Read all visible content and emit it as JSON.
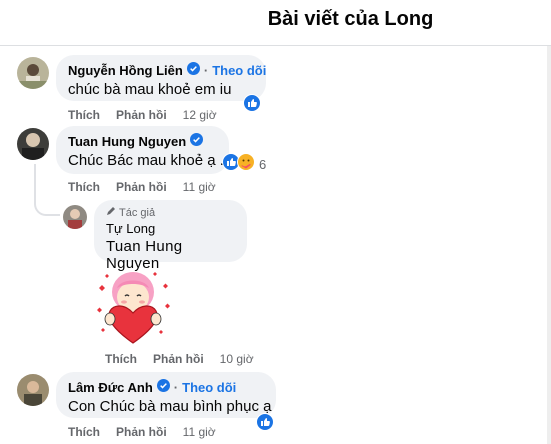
{
  "header": {
    "title": "Bài viết của Long"
  },
  "comments": [
    {
      "name": "Nguyễn Hồng Liên",
      "follow": "Theo dõi",
      "text": "chúc bà mau khoẻ em iu",
      "like": "Thích",
      "reply": "Phản hồi",
      "time": "12 giờ"
    },
    {
      "name": "Tuan Hung Nguyen",
      "text": "Chúc Bác mau khoẻ ạ .",
      "reaction_count": "6",
      "like": "Thích",
      "reply": "Phản hồi",
      "time": "11 giờ"
    },
    {
      "name": "Lâm Đức Anh",
      "follow": "Theo dõi",
      "text": "Con Chúc bà mau bình phục ạ",
      "like": "Thích",
      "reply": "Phản hồi",
      "time": "11 giờ"
    }
  ],
  "reply": {
    "author_tag": "Tác giả",
    "name": "Tự Long",
    "text": "Tuan Hung Nguyen",
    "like": "Thích",
    "reply": "Phản hồi",
    "time": "10 giờ"
  },
  "colors": {
    "accent": "#1b74e4",
    "bubble": "#f0f2f5",
    "meta": "#65676b"
  },
  "icons": [
    "verified-badge-icon",
    "like-reaction-icon",
    "care-reaction-icon",
    "pencil-icon",
    "heart-sticker"
  ]
}
